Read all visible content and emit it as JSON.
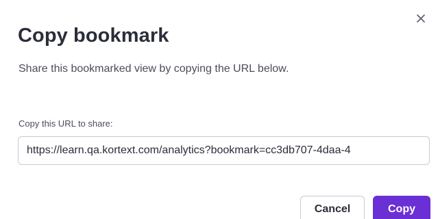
{
  "dialog": {
    "title": "Copy bookmark",
    "subtitle": "Share this bookmarked view by copying the URL below.",
    "close_icon": "close-icon",
    "field_label": "Copy this URL to share:",
    "url_value": "https://learn.qa.kortext.com/analytics?bookmark=cc3db707-4daa-4",
    "cancel_label": "Cancel",
    "copy_label": "Copy"
  },
  "colors": {
    "primary": "#6b2fd6",
    "text": "#2b2d3a",
    "border": "#c8cad3"
  }
}
